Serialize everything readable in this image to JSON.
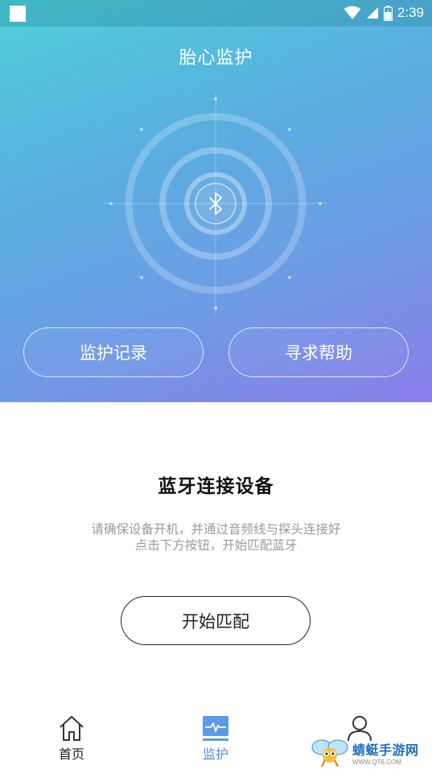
{
  "status_bar": {
    "time": "2:39"
  },
  "page": {
    "title": "胎心监护"
  },
  "hero_buttons": {
    "records": "监护记录",
    "help": "寻求帮助"
  },
  "connect": {
    "heading": "蓝牙连接设备",
    "desc_line1": "请确保设备开机，并通过音频线与探头连接好",
    "desc_line2": "点击下方按钮，开始匹配蓝牙",
    "button": "开始匹配"
  },
  "tabbar": {
    "items": [
      {
        "label": "首页",
        "icon": "home-icon"
      },
      {
        "label": "监护",
        "icon": "monitor-icon",
        "active": true
      },
      {
        "label": "",
        "icon": "user-icon"
      }
    ]
  },
  "watermark": {
    "title": "蜻蜓手游网",
    "url": "WWW.QT6.COM"
  },
  "colors": {
    "gradient_top": "#4fd0d9",
    "gradient_bottom": "#8a7ee9",
    "active_tab": "#4a8fe2"
  }
}
